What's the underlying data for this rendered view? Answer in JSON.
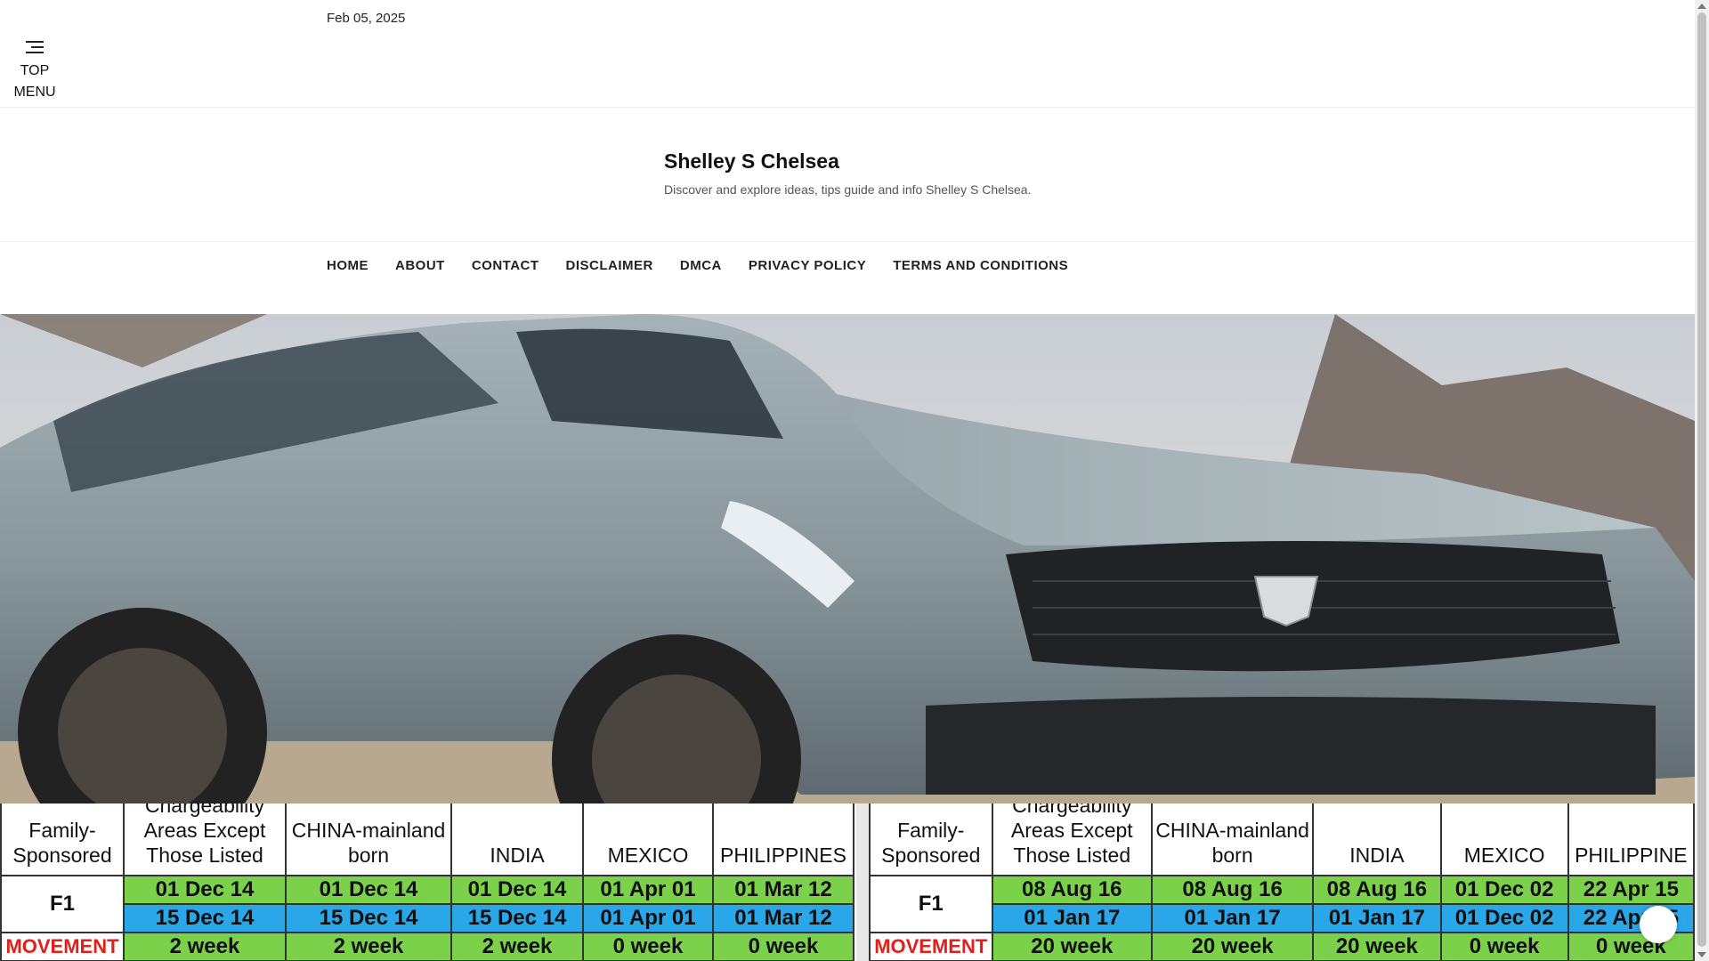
{
  "topbar": {
    "date": "Feb 05, 2025",
    "menu_label_line1": "TOP",
    "menu_label_line2": "MENU"
  },
  "site": {
    "title": "Shelley S Chelsea",
    "description": "Discover and explore ideas, tips guide and info Shelley S Chelsea."
  },
  "nav": {
    "items": [
      {
        "label": "HOME"
      },
      {
        "label": "ABOUT"
      },
      {
        "label": "CONTACT"
      },
      {
        "label": "DISCLAIMER"
      },
      {
        "label": "DMCA"
      },
      {
        "label": "PRIVACY POLICY"
      },
      {
        "label": "TERMS AND CONDITIONS"
      }
    ]
  },
  "hero": {
    "alt_icon": "car-photo"
  },
  "visa_table_left": {
    "headers": [
      "Family-\nSponsored",
      "Chargeability\nAreas Except\nThose Listed",
      "CHINA-mainland\nborn",
      "INDIA",
      "MEXICO",
      "PHILIPPINES"
    ],
    "category": "F1",
    "row1": [
      "01 Dec 14",
      "01 Dec 14",
      "01 Dec 14",
      "01 Apr 01",
      "01 Mar 12"
    ],
    "row2": [
      "15 Dec 14",
      "15 Dec 14",
      "15 Dec 14",
      "01 Apr 01",
      "01 Mar 12"
    ],
    "movement_label": "MOVEMENT",
    "movement": [
      "2 week",
      "2 week",
      "2 week",
      "0 week",
      "0 week"
    ]
  },
  "visa_table_right": {
    "headers": [
      "Family-\nSponsored",
      "Chargeability\nAreas Except\nThose Listed",
      "CHINA-mainland\nborn",
      "INDIA",
      "MEXICO",
      "PHILIPPINE"
    ],
    "category": "F1",
    "row1": [
      "08 Aug 16",
      "08 Aug 16",
      "08 Aug 16",
      "01 Dec 02",
      "22 Apr 15"
    ],
    "row2": [
      "01 Jan 17",
      "01 Jan 17",
      "01 Jan 17",
      "01 Dec 02",
      "22 Apr 15"
    ],
    "movement_label": "MOVEMENT",
    "movement": [
      "20 week",
      "20 week",
      "20 week",
      "0 week",
      "0 week"
    ]
  },
  "colors": {
    "green": "#7bd14a",
    "blue": "#2aa7e8",
    "movement_red": "#e0201b"
  }
}
